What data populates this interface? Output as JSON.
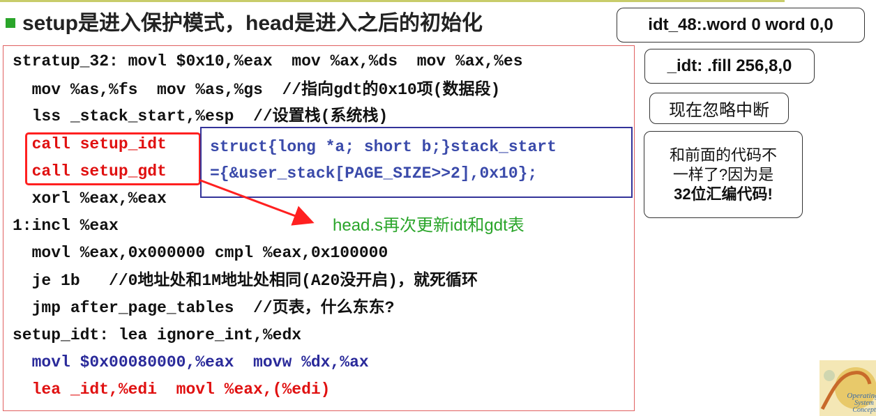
{
  "slide": {
    "title": "setup是进入保护模式，head是进入之后的初始化",
    "code_lines": [
      "stratup_32: movl $0x10,%eax  mov %ax,%ds  mov %ax,%es",
      "  mov %as,%fs  mov %as,%gs  //指向gdt的0x10项(数据段)",
      "  lss _stack_start,%esp  //设置栈(系统栈)",
      "  call setup_idt",
      "  call setup_gdt",
      "  xorl %eax,%eax",
      "1:incl %eax",
      "  movl %eax,0x000000 cmpl %eax,0x100000",
      "  je 1b   //0地址处和1M地址处相同(A20没开启)，就死循环",
      "  jmp after_page_tables  //页表，什么东东?",
      "setup_idt: lea ignore_int,%edx",
      "  movl $0x00080000,%eax  movw %dx,%ax",
      "  lea _idt,%edi  movl %eax,(%edi)"
    ],
    "struct_box": {
      "line1": "struct{long *a; short b;}stack_start",
      "line2": "={&user_stack[PAGE_SIZE>>2],0x10};"
    },
    "annotation": "head.s再次更新idt和gdt表",
    "side_notes": {
      "idt48": "idt_48:.word 0  word 0,0",
      "idt_fill": "_idt: .fill 256,8,0",
      "ignore_interrupts": "现在忽略中断",
      "diff_line1": "和前面的代码不",
      "diff_line2": "一样了?因为是",
      "diff_line3": "32位汇编代码!"
    },
    "logo": {
      "line1": "Operating",
      "line2": "System",
      "line3": "Concepts"
    },
    "colors": {
      "accent_green": "#2aa52a",
      "code_red": "#e01010",
      "code_blue": "#2a2a9a",
      "struct_blue": "#3a4aaa"
    }
  }
}
